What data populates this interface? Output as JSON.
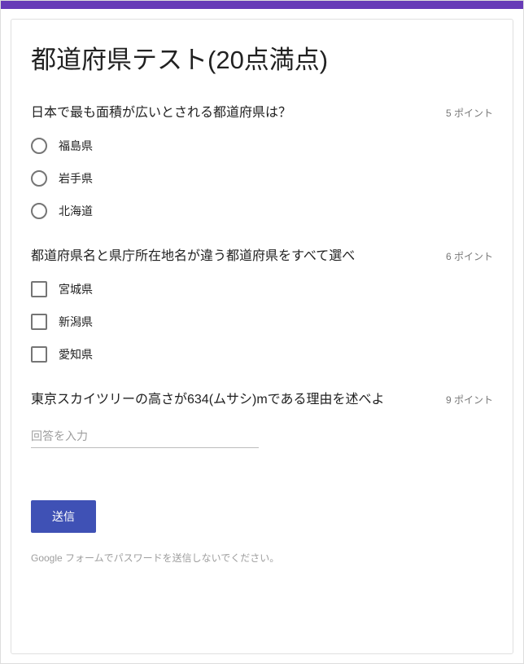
{
  "form": {
    "title": "都道府県テスト(20点満点)"
  },
  "questions": [
    {
      "title": "日本で最も面積が広いとされる都道府県は？",
      "points": "5 ポイント",
      "type": "radio",
      "options": [
        "福島県",
        "岩手県",
        "北海道"
      ]
    },
    {
      "title": "都道府県名と県庁所在地名が違う都道府県をすべて選べ",
      "points": "6 ポイント",
      "type": "checkbox",
      "options": [
        "宮城県",
        "新潟県",
        "愛知県"
      ]
    },
    {
      "title": "東京スカイツリーの高さが634(ムサシ)mである理由を述べよ",
      "points": "9 ポイント",
      "type": "text",
      "placeholder": "回答を入力"
    }
  ],
  "submit_label": "送信",
  "footer": "Google フォームでパスワードを送信しないでください。"
}
